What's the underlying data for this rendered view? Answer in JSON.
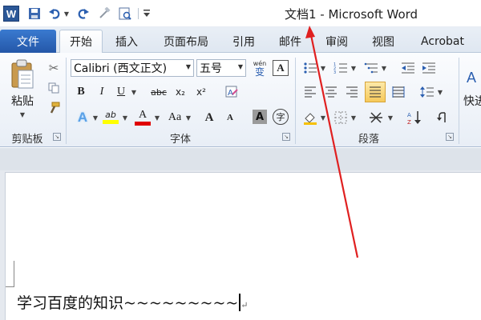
{
  "title_bar": {
    "app_logo": "W",
    "quick_access": [
      "save-icon",
      "undo-icon",
      "redo-icon",
      "format-painter-icon",
      "print-preview-icon",
      "customize-icon"
    ],
    "title": "文档1 - Microsoft Word"
  },
  "tabs": {
    "file": "文件",
    "items": [
      "开始",
      "插入",
      "页面布局",
      "引用",
      "邮件",
      "审阅",
      "视图",
      "Acrobat"
    ],
    "active": "开始"
  },
  "ribbon": {
    "clipboard": {
      "paste_label": "粘贴",
      "cut": "✂",
      "group_label": "剪贴板"
    },
    "font": {
      "font_name": "Calibri (西文正文)",
      "font_size": "五号",
      "wen_label": "wén",
      "wen_char": "变",
      "a_box": "A",
      "bold": "B",
      "italic": "I",
      "underline": "U",
      "strike": "abc",
      "subscript": "x₂",
      "superscript": "x²",
      "effects": "A",
      "highlight": "ab",
      "font_color": "A",
      "case": "Aa",
      "grow": "A",
      "shrink": "A",
      "char_shade": "A",
      "enclose": "字",
      "group_label": "字体"
    },
    "paragraph": {
      "group_label": "段落"
    },
    "styles": {
      "quick_label": "快进"
    }
  },
  "document": {
    "text": "学习百度的知识~~~~~~~~~",
    "mark": "↵"
  },
  "colors": {
    "accent": "#2b5797",
    "file_tab": "#2e63b8",
    "arrow": "#e02020",
    "highlight": "#ffff00",
    "font_color": "#e00000"
  }
}
